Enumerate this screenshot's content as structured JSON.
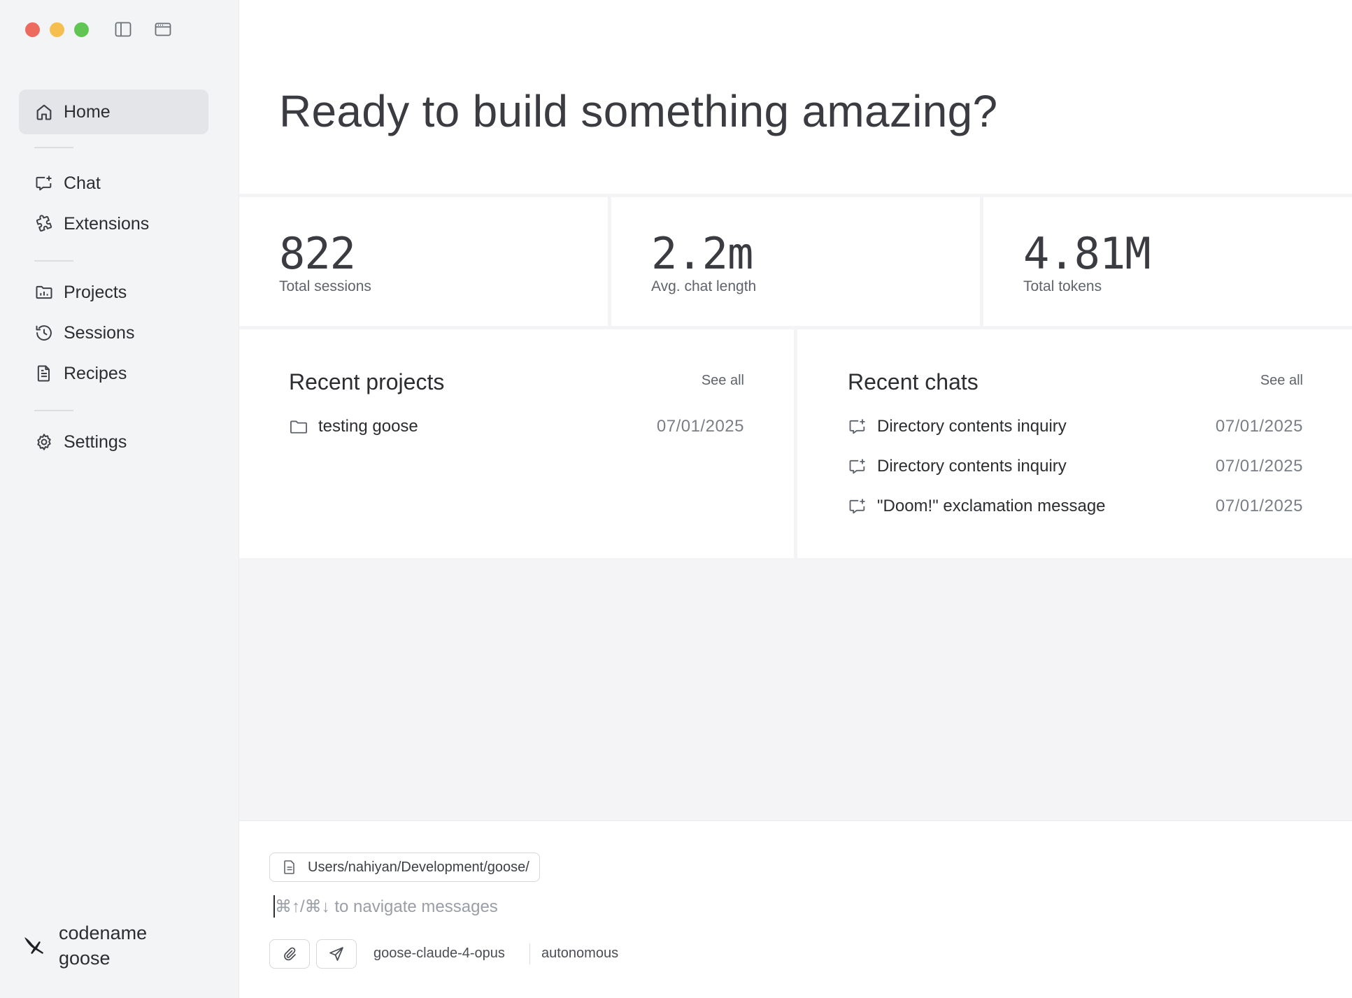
{
  "window": {
    "controls": [
      "close",
      "minimize",
      "zoom"
    ],
    "toolbar_icons": [
      "sidebar-toggle-icon",
      "browser-window-icon"
    ]
  },
  "sidebar": {
    "items": [
      {
        "label": "Home",
        "icon": "home-icon",
        "active": true
      },
      {
        "label": "Chat",
        "icon": "chat-icon"
      },
      {
        "label": "Extensions",
        "icon": "puzzle-icon"
      },
      {
        "label": "Projects",
        "icon": "folder-chart-icon"
      },
      {
        "label": "Sessions",
        "icon": "history-icon"
      },
      {
        "label": "Recipes",
        "icon": "document-icon"
      },
      {
        "label": "Settings",
        "icon": "gear-icon"
      }
    ],
    "brand_line1": "codename",
    "brand_line2": "goose"
  },
  "hero": {
    "title": "Ready to build something amazing?"
  },
  "stats": [
    {
      "value": "822",
      "label": "Total sessions"
    },
    {
      "value": "2.2m",
      "label": "Avg. chat length"
    },
    {
      "value": "4.81M",
      "label": "Total tokens"
    }
  ],
  "recent_projects": {
    "title": "Recent projects",
    "see_all": "See all",
    "items": [
      {
        "name": "testing goose",
        "date": "07/01/2025",
        "icon": "folder-icon"
      }
    ]
  },
  "recent_chats": {
    "title": "Recent chats",
    "see_all": "See all",
    "items": [
      {
        "name": "Directory contents inquiry",
        "date": "07/01/2025",
        "icon": "chat-icon"
      },
      {
        "name": "Directory contents inquiry",
        "date": "07/01/2025",
        "icon": "chat-icon"
      },
      {
        "name": "\"Doom!\" exclamation message",
        "date": "07/01/2025",
        "icon": "chat-icon"
      }
    ]
  },
  "composer": {
    "directory": "Users/nahiyan/Development/goose/",
    "placeholder": "⌘↑/⌘↓ to navigate messages",
    "model": "goose-claude-4-opus",
    "mode": "autonomous"
  },
  "colors": {
    "sidebar_bg": "#f3f4f6",
    "active_item_bg": "#e4e5e9",
    "close": "#ed6a5e",
    "minimize": "#f5bf4f",
    "zoom": "#61c554"
  }
}
